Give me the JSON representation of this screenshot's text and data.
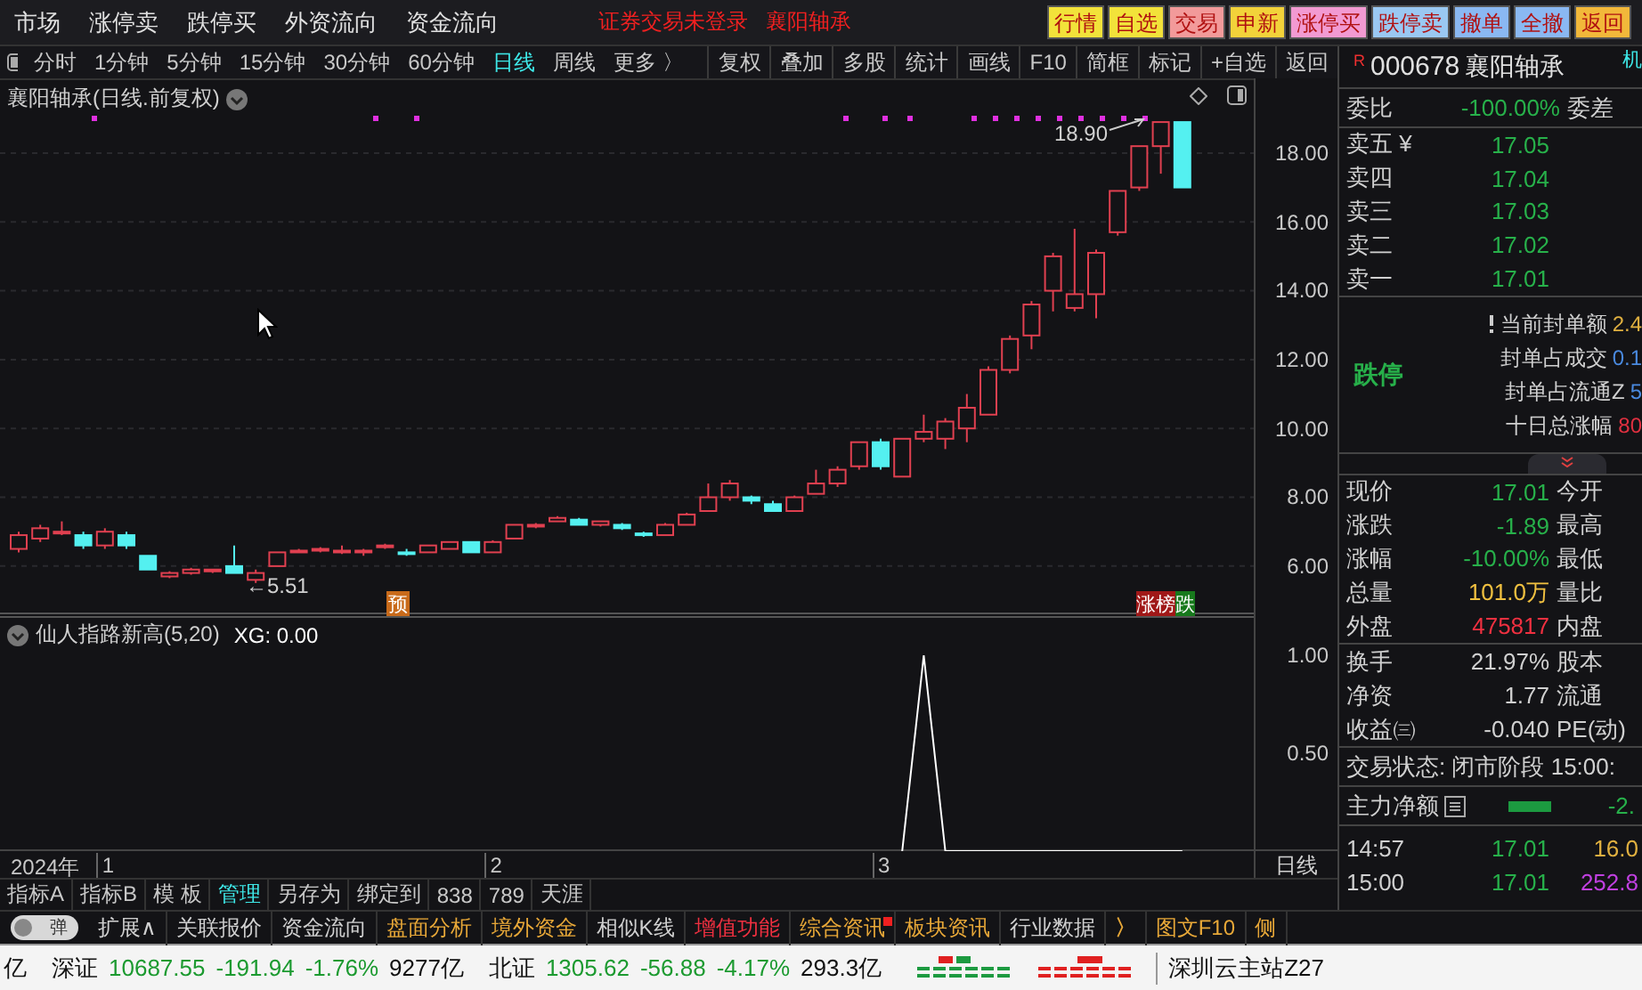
{
  "menu": [
    "市场",
    "涨停卖",
    "跌停买",
    "外资流向",
    "资金流向"
  ],
  "notice": {
    "login": "证券交易未登录",
    "stock": "襄阳轴承"
  },
  "quick_buttons": [
    {
      "label": "行情",
      "color": "#f2e23a"
    },
    {
      "label": "自选",
      "color": "#f2e23a"
    },
    {
      "label": "交易",
      "color": "#f29a9a"
    },
    {
      "label": "申新",
      "color": "#f2d23a"
    },
    {
      "label": "涨停买",
      "color": "#f29ad2"
    },
    {
      "label": "跌停卖",
      "color": "#9ac8f2"
    },
    {
      "label": "撤单",
      "color": "#8ab8f2"
    },
    {
      "label": "全撤",
      "color": "#8ab8f2"
    },
    {
      "label": "返回",
      "color": "#f2b83a"
    }
  ],
  "periods": [
    {
      "label": "分时",
      "selected": false
    },
    {
      "label": "1分钟",
      "selected": false
    },
    {
      "label": "5分钟",
      "selected": false
    },
    {
      "label": "15分钟",
      "selected": false
    },
    {
      "label": "30分钟",
      "selected": false
    },
    {
      "label": "60分钟",
      "selected": false
    },
    {
      "label": "日线",
      "selected": true
    },
    {
      "label": "周线",
      "selected": false
    },
    {
      "label": "更多 〉",
      "selected": false
    }
  ],
  "tools": [
    "复权",
    "叠加",
    "多股",
    "统计",
    "画线",
    "F10",
    "简框",
    "标记",
    "+自选",
    "返回"
  ],
  "chart": {
    "title": "襄阳轴承(日线.前复权)",
    "high_label": "18.90",
    "low_label": "←5.51",
    "pre_badge": "预",
    "rank_badge": [
      {
        "text": "涨榜",
        "color": "#a01818"
      },
      {
        "text": "跌",
        "color": "#17791c"
      }
    ],
    "chart_data": {
      "type": "candlestick",
      "ylim": [
        4.6,
        20.17
      ],
      "grid": true,
      "yticks": [
        {
          "value": 18,
          "label": "18.00"
        },
        {
          "value": 16,
          "label": "16.00"
        },
        {
          "value": 14,
          "label": "14.00"
        },
        {
          "value": 12,
          "label": "12.00"
        },
        {
          "value": 10,
          "label": "10.00"
        },
        {
          "value": 8,
          "label": "8.00"
        },
        {
          "value": 6,
          "label": "6.00"
        }
      ],
      "ohlc": [
        [
          6.5,
          7,
          6.4,
          6.9
        ],
        [
          6.8,
          7.2,
          6.7,
          7.1
        ],
        [
          7,
          7.3,
          6.9,
          7
        ],
        [
          6.9,
          7,
          6.5,
          6.6
        ],
        [
          6.6,
          7.1,
          6.5,
          7
        ],
        [
          6.9,
          7,
          6.5,
          6.6
        ],
        [
          6.3,
          6.3,
          5.9,
          5.9
        ],
        [
          5.7,
          5.85,
          5.65,
          5.8
        ],
        [
          5.8,
          5.95,
          5.75,
          5.9
        ],
        [
          5.85,
          5.9,
          5.8,
          5.9
        ],
        [
          6,
          6.6,
          5.8,
          5.8
        ],
        [
          5.6,
          5.9,
          5.51,
          5.8
        ],
        [
          6,
          6.4,
          6,
          6.4
        ],
        [
          6.4,
          6.5,
          6.4,
          6.45
        ],
        [
          6.45,
          6.55,
          6.4,
          6.5
        ],
        [
          6.45,
          6.6,
          6.35,
          6.45
        ],
        [
          6.4,
          6.5,
          6.3,
          6.45
        ],
        [
          6.55,
          6.65,
          6.5,
          6.6
        ],
        [
          6.4,
          6.5,
          6.3,
          6.35
        ],
        [
          6.4,
          6.6,
          6.4,
          6.6
        ],
        [
          6.5,
          6.7,
          6.5,
          6.7
        ],
        [
          6.7,
          6.7,
          6.4,
          6.4
        ],
        [
          6.4,
          6.75,
          6.4,
          6.7
        ],
        [
          6.8,
          7.2,
          6.8,
          7.2
        ],
        [
          7.15,
          7.25,
          7.1,
          7.2
        ],
        [
          7.3,
          7.45,
          7.3,
          7.4
        ],
        [
          7.35,
          7.4,
          7.2,
          7.2
        ],
        [
          7.2,
          7.3,
          7.15,
          7.3
        ],
        [
          7.2,
          7.25,
          7.05,
          7.1
        ],
        [
          6.95,
          7,
          6.85,
          6.9
        ],
        [
          6.9,
          7.25,
          6.9,
          7.2
        ],
        [
          7.2,
          7.55,
          7.2,
          7.5
        ],
        [
          7.6,
          8.4,
          7.6,
          8
        ],
        [
          8,
          8.5,
          7.9,
          8.4
        ],
        [
          8,
          8.05,
          7.8,
          7.9
        ],
        [
          7.8,
          7.9,
          7.6,
          7.6
        ],
        [
          7.6,
          8.05,
          7.6,
          8
        ],
        [
          8.1,
          8.8,
          8.1,
          8.4
        ],
        [
          8.4,
          8.9,
          8.3,
          8.8
        ],
        [
          8.9,
          9.6,
          8.8,
          9.6
        ],
        [
          9.6,
          9.7,
          8.8,
          8.9
        ],
        [
          8.6,
          9.7,
          8.6,
          9.7
        ],
        [
          9.7,
          10.4,
          9.6,
          9.9
        ],
        [
          9.7,
          10.3,
          9.4,
          10.2
        ],
        [
          10,
          11,
          9.6,
          10.6
        ],
        [
          10.4,
          11.8,
          10.4,
          11.7
        ],
        [
          11.7,
          12.7,
          11.6,
          12.6
        ],
        [
          12.7,
          13.7,
          12.3,
          13.6
        ],
        [
          14,
          15.1,
          13.4,
          15
        ],
        [
          13.5,
          15.8,
          13.4,
          13.9
        ],
        [
          13.9,
          15.2,
          13.2,
          15.1
        ],
        [
          15.7,
          16.9,
          15.6,
          16.9
        ],
        [
          17,
          18.2,
          16.9,
          18.2
        ],
        [
          18.2,
          18.9,
          17.4,
          18.9
        ],
        [
          18.9,
          18.9,
          17,
          17
        ]
      ]
    }
  },
  "indicator": {
    "title": "仙人指路新高(5,20)",
    "xg_value": ": 0.00",
    "chart_data": {
      "type": "line",
      "ylim": [
        0,
        1.21
      ],
      "yticks": [
        {
          "value": 0.5,
          "label": "0.50"
        },
        {
          "value": 1,
          "label": "1.00"
        }
      ],
      "series": [
        {
          "name": "XG",
          "color": "#ffffff",
          "values": [
            null,
            null,
            null,
            null,
            null,
            null,
            null,
            null,
            null,
            null,
            null,
            null,
            null,
            null,
            null,
            null,
            null,
            null,
            null,
            null,
            null,
            null,
            null,
            null,
            null,
            null,
            null,
            null,
            null,
            null,
            null,
            null,
            null,
            null,
            null,
            null,
            null,
            null,
            null,
            null,
            null,
            0,
            1,
            0,
            0,
            0,
            0,
            0,
            0,
            0,
            0,
            0,
            0,
            0,
            0
          ]
        }
      ]
    }
  },
  "date_axis": {
    "year": "2024年",
    "months": [
      "1",
      "2",
      "3"
    ],
    "period": "日线"
  },
  "quote_header": {
    "flag": "R",
    "code": "000678",
    "name": "襄阳轴承",
    "extra": "机"
  },
  "order_ratio": {
    "label": "委比",
    "value": "-100.00%",
    "label2": "委差"
  },
  "asks": [
    {
      "label": "卖五",
      "mark": "¥",
      "price": "17.05"
    },
    {
      "label": "卖四",
      "price": "17.04"
    },
    {
      "label": "卖三",
      "price": "17.03"
    },
    {
      "label": "卖二",
      "price": "17.02"
    },
    {
      "label": "卖一",
      "price": "17.01"
    }
  ],
  "limit": {
    "status": "跌停",
    "rows": [
      {
        "label": "当前封单额",
        "value": "2.4",
        "color": "#e0b040"
      },
      {
        "label": "封单占成交",
        "value": "0.1",
        "color": "#4a8ae0"
      },
      {
        "label": "封单占流通Z",
        "value": "5",
        "color": "#4a8ae0"
      },
      {
        "label": "十日总涨幅",
        "value": "80",
        "color": "#e03040"
      }
    ]
  },
  "quote": [
    {
      "label": "现价",
      "value": "17.01",
      "label2": "今开",
      "color": "#27b04a"
    },
    {
      "label": "涨跌",
      "value": "-1.89",
      "label2": "最高",
      "color": "#27b04a"
    },
    {
      "label": "涨幅",
      "value": "-10.00%",
      "label2": "最低",
      "color": "#27b04a"
    },
    {
      "label": "总量",
      "value": "101.0万",
      "label2": "量比",
      "color": "#f0c040"
    },
    {
      "label": "外盘",
      "value": "475817",
      "label2": "内盘",
      "color": "#f03040"
    }
  ],
  "finance": [
    {
      "label": "换手",
      "value": "21.97%",
      "label2": "股本"
    },
    {
      "label": "净资",
      "value": "1.77",
      "label2": "流通"
    },
    {
      "label": "收益㈢",
      "value": "-0.040",
      "label2": "PE(动)"
    }
  ],
  "trade_status": "交易状态: 闭市阶段 15:00:",
  "main_force": {
    "label": "主力净额",
    "value": "-2."
  },
  "ticks": [
    {
      "time": "14:57",
      "price": "17.01",
      "volume": "16.0",
      "color": "#e0b040"
    },
    {
      "time": "15:00",
      "price": "17.01",
      "volume": "252.8",
      "color": "#c040e0"
    }
  ],
  "tabs": [
    {
      "label": "指标A",
      "selected": false
    },
    {
      "label": "指标B",
      "selected": false
    },
    {
      "label": "模 板",
      "selected": false
    },
    {
      "label": "管理",
      "selected": true
    },
    {
      "label": "另存为",
      "selected": false
    },
    {
      "label": "绑定到",
      "selected": false
    },
    {
      "label": "838",
      "selected": false
    },
    {
      "label": "789",
      "selected": false
    },
    {
      "label": "天涯",
      "selected": false
    }
  ],
  "toggle": {
    "label": "弹",
    "on": false
  },
  "features": [
    {
      "label": "扩展∧",
      "color": "#d0d0d0"
    },
    {
      "label": "关联报价",
      "color": "#d0d0d0"
    },
    {
      "label": "资金流向",
      "color": "#d0d0d0"
    },
    {
      "label": "盘面分析",
      "color": "#e8a838"
    },
    {
      "label": "境外资金",
      "color": "#e8a838"
    },
    {
      "label": "相似K线",
      "color": "#d0d0d0"
    },
    {
      "label": "增值功能",
      "color": "#f03040"
    },
    {
      "label": "综合资讯",
      "color": "#e8a838",
      "dot": true
    },
    {
      "label": "板块资讯",
      "color": "#e8a838"
    },
    {
      "label": "行业数据",
      "color": "#d0d0d0"
    },
    {
      "label": "〉",
      "color": "#e8a838"
    },
    {
      "label": "图文F10",
      "color": "#e8a838"
    },
    {
      "label": "侧",
      "color": "#e8a838"
    }
  ],
  "status": {
    "lead": "亿",
    "markets": [
      {
        "name": "深证",
        "index": "10687.55",
        "change": "-191.94",
        "pct": "-1.76%",
        "amount": "9277亿"
      },
      {
        "name": "北证",
        "index": "1305.62",
        "change": "-56.88",
        "pct": "-4.17%",
        "amount": "293.3亿"
      }
    ],
    "server": "深圳云主站Z27"
  }
}
